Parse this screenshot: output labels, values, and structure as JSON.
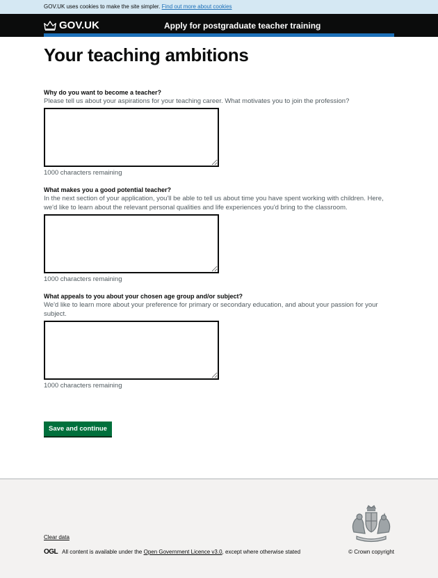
{
  "cookie_banner": {
    "text": "GOV.UK uses cookies to make the site simpler.",
    "link": "Find out more about cookies"
  },
  "header": {
    "logo_text": "GOV.UK",
    "service_name": "Apply for postgraduate teacher training"
  },
  "page": {
    "title": "Your teaching ambitions"
  },
  "questions": [
    {
      "label": "Why do you want to become a teacher?",
      "hint": "Please tell us about your aspirations for your teaching career. What motivates you to join the profession?",
      "value": "",
      "remaining": "1000 characters remaining"
    },
    {
      "label": "What makes you a good potential teacher?",
      "hint": "In the next section of your application, you'll be able to tell us about time you have spent working with children. Here, we'd like to learn about the relevant personal qualities and life experiences you'd bring to the classroom.",
      "value": "",
      "remaining": "1000 characters remaining"
    },
    {
      "label": "What appeals to you about your chosen age group and/or subject?",
      "hint": "We'd like to learn more about your preference for primary or secondary education, and about your passion for your subject.",
      "value": "",
      "remaining": "1000 characters remaining"
    }
  ],
  "actions": {
    "save_label": "Save and continue"
  },
  "footer": {
    "clear_data": "Clear data",
    "ogl_logo": "OGL",
    "licence_prefix": "All content is available under the",
    "licence_link": "Open Government Licence v3.0",
    "licence_suffix": ", except where otherwise stated",
    "copyright": "© Crown copyright"
  },
  "colors": {
    "header_bg": "#0b0c0c",
    "accent_blue": "#1d70b8",
    "button_green": "#00703c",
    "footer_bg": "#f3f2f1"
  }
}
